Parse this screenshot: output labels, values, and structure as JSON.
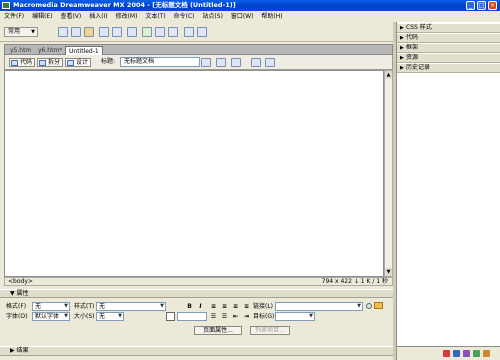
{
  "window": {
    "title": "Macromedia Dreamweaver MX 2004 - [无标题文档 (Untitled-1)]",
    "minimize": "_",
    "maximize": "□",
    "close": "×"
  },
  "menubar": [
    "文件(F)",
    "编辑(E)",
    "查看(V)",
    "插入(I)",
    "修改(M)",
    "文本(T)",
    "命令(C)",
    "站点(S)",
    "窗口(W)",
    "帮助(H)"
  ],
  "insert_bar": {
    "category": "常用"
  },
  "doc_tabs": [
    {
      "label": "y5.htm"
    },
    {
      "label": "y6.htm*"
    },
    {
      "label": "Untitled-1"
    }
  ],
  "doc_toolbar": {
    "code_label": "代码",
    "split_label": "拆分",
    "design_label": "设计",
    "title_label": "标题:",
    "title_value": "无标题文档"
  },
  "statusbar": {
    "tag": "<body>",
    "info": "794 x 422 ↓ 1 K / 1 秒"
  },
  "properties": {
    "header": "▼ 属性",
    "format_label": "格式(F)",
    "format_value": "无",
    "style_label": "样式(T)",
    "style_value": "无",
    "bold": "B",
    "italic": "I",
    "link_label": "链接(L)",
    "link_value": "",
    "font_label": "字体(O)",
    "font_value": "默认字体",
    "size_label": "大小(S)",
    "size_value": "无",
    "target_label": "目标(G)",
    "page_props_button": "页面属性...",
    "list_item_button": "列表项目..."
  },
  "results_header": "▶ 结果",
  "right_panels": [
    "CSS 样式",
    "代码",
    "框架",
    "资源",
    "历史记录"
  ]
}
